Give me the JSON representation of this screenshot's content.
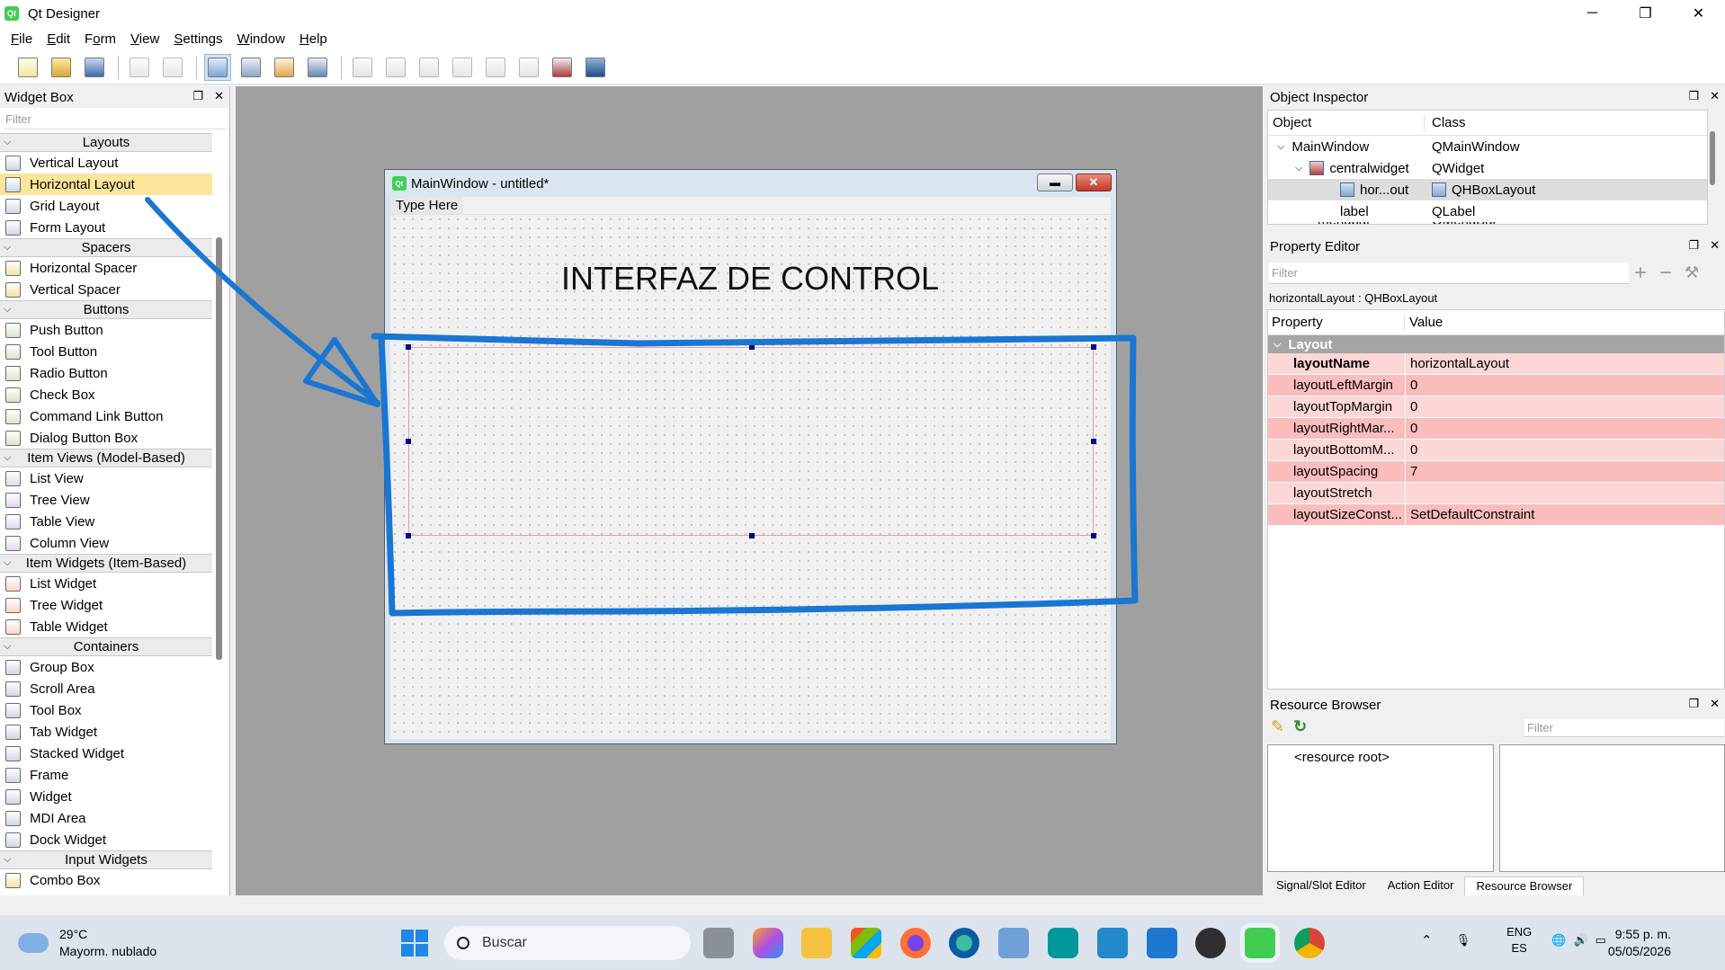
{
  "window": {
    "title": "Qt Designer",
    "minimize": "─",
    "maximize": "❐",
    "close": "✕"
  },
  "menubar": [
    {
      "label": "File",
      "key": "F"
    },
    {
      "label": "Edit",
      "key": "E"
    },
    {
      "label": "Form",
      "key": "o"
    },
    {
      "label": "View",
      "key": "V"
    },
    {
      "label": "Settings",
      "key": "S"
    },
    {
      "label": "Window",
      "key": "W"
    },
    {
      "label": "Help",
      "key": "H"
    }
  ],
  "widget_box": {
    "title": "Widget Box",
    "filter_placeholder": "Filter",
    "sections": [
      {
        "name": "Layouts",
        "items": [
          "Vertical Layout",
          "Horizontal Layout",
          "Grid Layout",
          "Form Layout"
        ]
      },
      {
        "name": "Spacers",
        "items": [
          "Horizontal Spacer",
          "Vertical Spacer"
        ]
      },
      {
        "name": "Buttons",
        "items": [
          "Push Button",
          "Tool Button",
          "Radio Button",
          "Check Box",
          "Command Link Button",
          "Dialog Button Box"
        ]
      },
      {
        "name": "Item Views (Model-Based)",
        "items": [
          "List View",
          "Tree View",
          "Table View",
          "Column View"
        ]
      },
      {
        "name": "Item Widgets (Item-Based)",
        "items": [
          "List Widget",
          "Tree Widget",
          "Table Widget"
        ]
      },
      {
        "name": "Containers",
        "items": [
          "Group Box",
          "Scroll Area",
          "Tool Box",
          "Tab Widget",
          "Stacked Widget",
          "Frame",
          "Widget",
          "MDI Area",
          "Dock Widget"
        ]
      },
      {
        "name": "Input Widgets",
        "items": [
          "Combo Box"
        ]
      }
    ],
    "selected_item": "Horizontal Layout"
  },
  "form": {
    "title": "MainWindow - untitled*",
    "menu_placeholder": "Type Here",
    "label_text": "INTERFAZ DE CONTROL"
  },
  "object_inspector": {
    "title": "Object Inspector",
    "col_object": "Object",
    "col_class": "Class",
    "rows": [
      {
        "object": "MainWindow",
        "class": "QMainWindow"
      },
      {
        "object": "centralwidget",
        "class": "QWidget"
      },
      {
        "object": "hor...out",
        "class": "QHBoxLayout"
      },
      {
        "object": "label",
        "class": "QLabel"
      },
      {
        "object": "menubar",
        "class": "QMenuBar"
      }
    ]
  },
  "property_editor": {
    "title": "Property Editor",
    "filter_placeholder": "Filter",
    "object_class": "horizontalLayout : QHBoxLayout",
    "col_property": "Property",
    "col_value": "Value",
    "group": "Layout",
    "rows": [
      {
        "name": "layoutName",
        "value": "horizontalLayout"
      },
      {
        "name": "layoutLeftMargin",
        "value": "0"
      },
      {
        "name": "layoutTopMargin",
        "value": "0"
      },
      {
        "name": "layoutRightMar...",
        "value": "0"
      },
      {
        "name": "layoutBottomM...",
        "value": "0"
      },
      {
        "name": "layoutSpacing",
        "value": "7"
      },
      {
        "name": "layoutStretch",
        "value": ""
      },
      {
        "name": "layoutSizeConst...",
        "value": "SetDefaultConstraint"
      }
    ]
  },
  "resource_browser": {
    "title": "Resource Browser",
    "filter_placeholder": "Filter",
    "root": "<resource root>",
    "tabs": [
      "Signal/Slot Editor",
      "Action Editor",
      "Resource Browser"
    ]
  },
  "taskbar": {
    "weather_temp": "29°C",
    "weather_desc": "Mayorm. nublado",
    "search_placeholder": "Buscar",
    "lang_1": "ENG",
    "lang_2": "ES",
    "time": "9:55 p. m.",
    "date": "05/05/2026"
  }
}
